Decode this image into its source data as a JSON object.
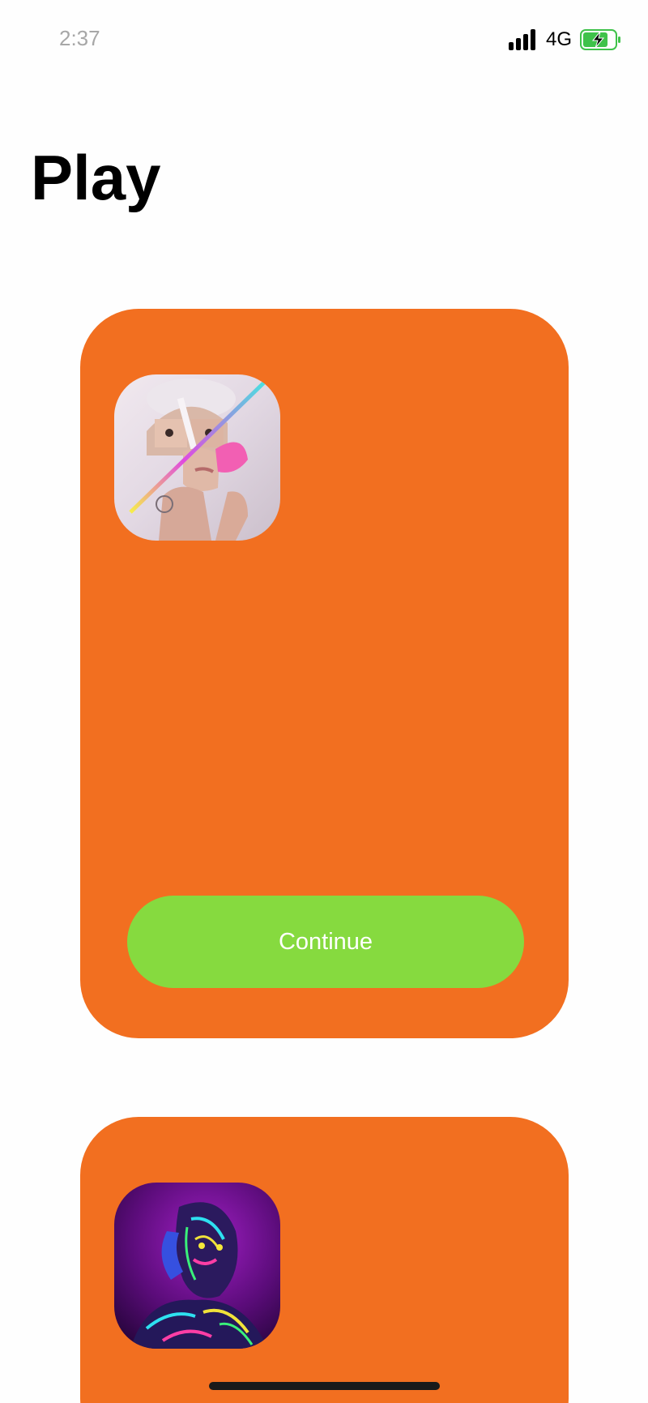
{
  "status_bar": {
    "time": "2:37",
    "network": "4G",
    "icons": [
      "signal-icon",
      "battery-charging-icon"
    ],
    "battery_color": "#3fc24a"
  },
  "page": {
    "title": "Play"
  },
  "cards": [
    {
      "thumbnail_icon": "portrait-collage-image",
      "button_label": "Continue"
    },
    {
      "thumbnail_icon": "neon-portrait-image"
    }
  ],
  "colors": {
    "card": "#f26f20",
    "button": "#86da3f",
    "background": "#fefefe"
  }
}
